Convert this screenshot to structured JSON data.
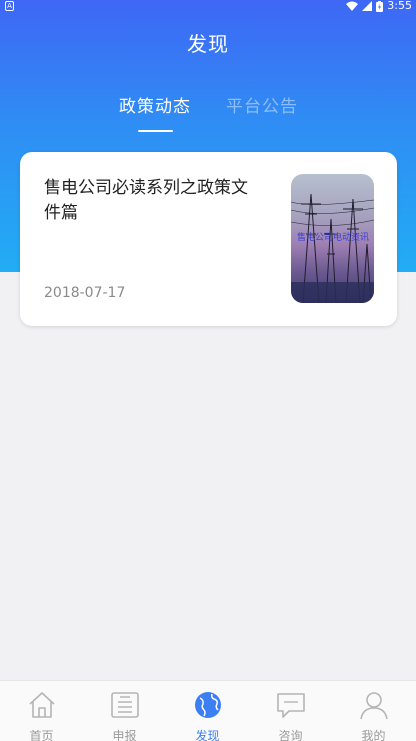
{
  "status_bar": {
    "time": "3:55",
    "left_icon": "A"
  },
  "header": {
    "title": "发现"
  },
  "tabs": [
    {
      "label": "政策动态",
      "active": true
    },
    {
      "label": "平台公告",
      "active": false
    }
  ],
  "articles": [
    {
      "title": "售电公司必读系列之政策文件篇",
      "date": "2018-07-17",
      "thumbnail_caption": "售电公司电动资讯"
    }
  ],
  "bottom_nav": [
    {
      "label": "首页",
      "icon": "home-icon"
    },
    {
      "label": "申报",
      "icon": "declare-icon"
    },
    {
      "label": "发现",
      "icon": "globe-icon",
      "active": true
    },
    {
      "label": "咨询",
      "icon": "chat-icon"
    },
    {
      "label": "我的",
      "icon": "user-icon"
    }
  ],
  "colors": {
    "header_gradient_top": "#3e67f5",
    "header_gradient_bottom": "#22adf4",
    "active_nav": "#3c7ff3",
    "inactive_nav": "#9a9a9a"
  }
}
